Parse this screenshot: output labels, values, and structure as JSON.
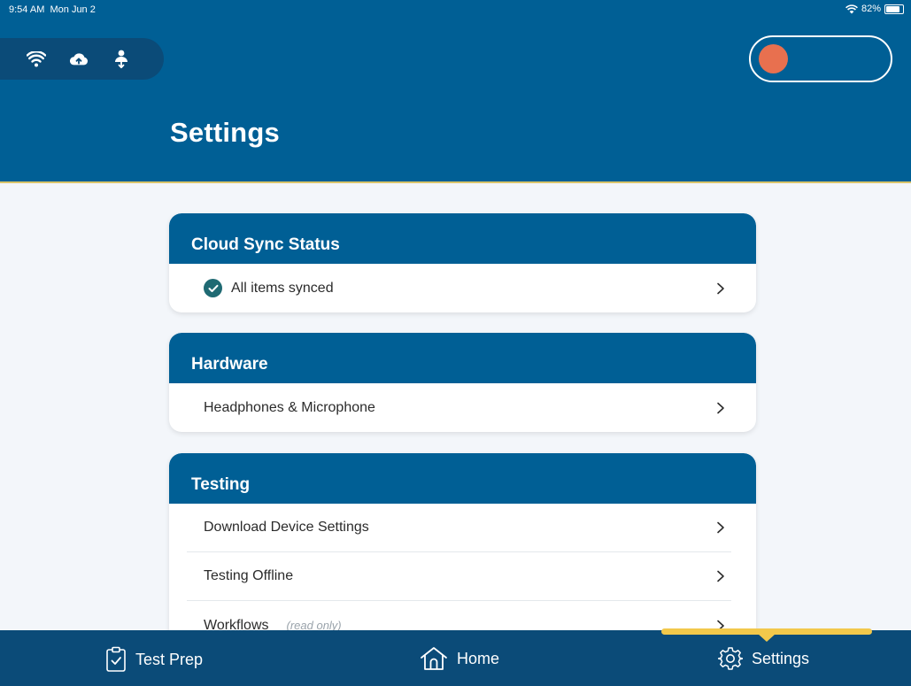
{
  "status_bar": {
    "time": "9:54 AM",
    "date": "Mon Jun 2",
    "battery": "82%",
    "battery_level": 0.82
  },
  "header": {
    "title": "Settings",
    "connection_icons": [
      "wifi-icon",
      "cloud-upload-icon",
      "person-download-icon"
    ],
    "recording_indicator_color": "#e8704f"
  },
  "sections": [
    {
      "title": "Cloud Sync Status",
      "items": [
        {
          "label": "All items synced",
          "icon": "check-circle-icon"
        }
      ]
    },
    {
      "title": "Hardware",
      "items": [
        {
          "label": "Headphones & Microphone"
        }
      ]
    },
    {
      "title": "Testing",
      "items": [
        {
          "label": "Download Device Settings"
        },
        {
          "label": "Testing Offline"
        },
        {
          "label": "Workflows",
          "sublabel": "(read only)"
        }
      ]
    }
  ],
  "tabs": [
    {
      "label": "Test Prep",
      "icon": "clipboard-check-icon"
    },
    {
      "label": "Home",
      "icon": "home-icon"
    },
    {
      "label": "Settings",
      "icon": "gear-icon",
      "active": true
    }
  ],
  "colors": {
    "brand_blue": "#005f95",
    "tabbar_navy": "#0b4b78",
    "accent_yellow": "#f2c84b",
    "background": "#f3f6fa",
    "record_orange": "#e8704f",
    "check_teal": "#1f6a73"
  }
}
